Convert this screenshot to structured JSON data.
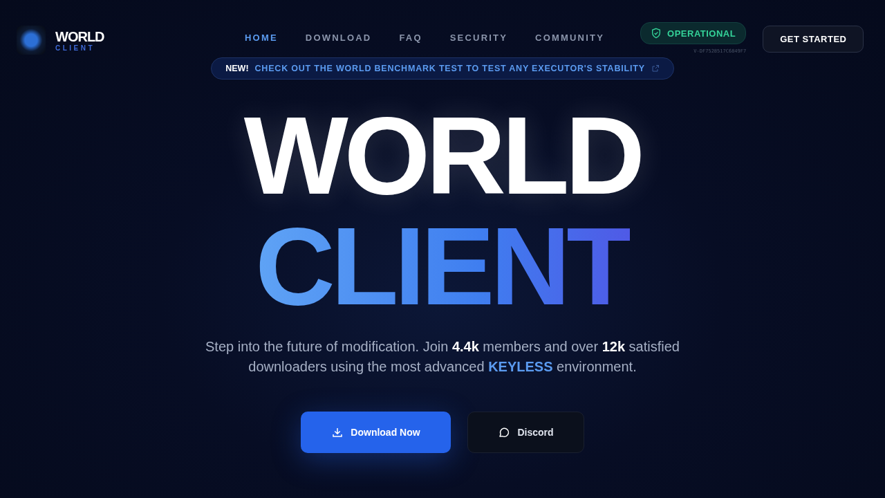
{
  "brand": {
    "name": "WORLD",
    "subtitle": "CLIENT"
  },
  "nav": [
    {
      "label": "HOME",
      "selected": true
    },
    {
      "label": "DOWNLOAD",
      "selected": false
    },
    {
      "label": "FAQ",
      "selected": false
    },
    {
      "label": "SECURITY",
      "selected": false
    },
    {
      "label": "COMMUNITY",
      "selected": false
    }
  ],
  "status": {
    "label": "OPERATIONAL",
    "version": "V-DF7528517C6849F7"
  },
  "cta": "GET STARTED",
  "announcement": {
    "badge": "NEW!",
    "text": "CHECK OUT THE WORLD BENCHMARK TEST TO TEST ANY EXECUTOR'S STABILITY"
  },
  "hero": {
    "title_line_1": "WORLD",
    "title_line_2": "CLIENT"
  },
  "description": [
    {
      "kind": "plain",
      "text": "Step into the future of modification. Join "
    },
    {
      "kind": "stat",
      "text": "4.4k"
    },
    {
      "kind": "plain",
      "text": " members and over "
    },
    {
      "kind": "stat",
      "text": "12k"
    },
    {
      "kind": "plain",
      "text": " satisfied downloaders using the most advanced "
    },
    {
      "kind": "highlight",
      "text": "KEYLESS"
    },
    {
      "kind": "plain",
      "text": " environment."
    }
  ],
  "buttons": [
    {
      "label": "Download Now",
      "kind": "primary"
    },
    {
      "label": "Discord",
      "kind": "secondary"
    }
  ]
}
